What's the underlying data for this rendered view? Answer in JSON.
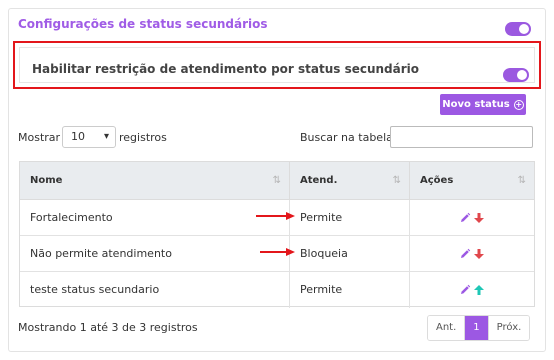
{
  "section": {
    "title": "Configurações de status secundários",
    "toggle_on": true,
    "restriction_label": "Habilitar restrição de atendimento por status secundário",
    "restriction_toggle_on": true
  },
  "toolbar": {
    "new_status_label": "Novo status",
    "new_status_icon": "plus-circle-icon"
  },
  "length": {
    "show_label": "Mostrar",
    "value": "10",
    "suffix": "registros"
  },
  "search": {
    "label": "Buscar na tabela:",
    "value": ""
  },
  "table": {
    "columns": [
      "Nome",
      "Atend.",
      "Ações"
    ],
    "rows": [
      {
        "name": "Fortalecimento",
        "atend": "Permite",
        "move_icon": "arrow-down-icon"
      },
      {
        "name": "Não permite atendimento",
        "atend": "Bloqueia",
        "move_icon": "arrow-down-icon"
      },
      {
        "name": "teste status secundario",
        "atend": "Permite",
        "move_icon": "arrow-up-icon"
      }
    ]
  },
  "footer": {
    "info": "Mostrando 1 até 3 de 3 registros",
    "prev": "Ant.",
    "page": "1",
    "next": "Próx."
  },
  "colors": {
    "accent": "#9c58e3",
    "highlight": "#e3161b",
    "arrow_down": "#e0474c",
    "arrow_up": "#1fc7b6"
  }
}
